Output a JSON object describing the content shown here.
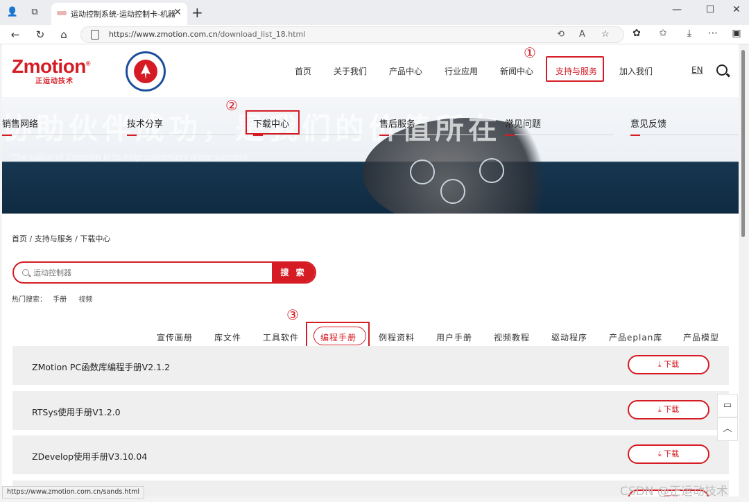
{
  "browser": {
    "tab_title": "运动控制系统-运动控制卡-机器人",
    "tab_close": "✕",
    "new_tab": "+",
    "url_host": "https://www.zmotion.com.cn",
    "url_path": "/download_list_18.html",
    "status_url": "https://www.zmotion.com.cn/sands.html"
  },
  "site": {
    "logo_text": "Zmotion",
    "logo_mark": "®",
    "logo_sub": "正运动技术",
    "nav": [
      "首页",
      "关于我们",
      "产品中心",
      "行业应用",
      "新闻中心",
      "支持与服务",
      "加入我们"
    ],
    "lang": "EN"
  },
  "banner": {
    "watermark": "协助伙伴成功，是我们的价值所在",
    "watermark_en": "The value of Zmotion is to help customers more success",
    "subnav": [
      "销售网络",
      "技术分享",
      "下载中心",
      "售后服务",
      "常见问题",
      "意见反馈"
    ]
  },
  "annotations": [
    "①",
    "②",
    "③"
  ],
  "breadcrumb": "首页 / 支持与服务 / 下载中心",
  "search": {
    "placeholder": "运动控制器",
    "button": "搜 索",
    "hot_label": "热门搜索：",
    "hot_items": [
      "手册",
      "视频"
    ]
  },
  "categories": [
    "宣传画册",
    "库文件",
    "工具软件",
    "编程手册",
    "例程资料",
    "用户手册",
    "视频教程",
    "驱动程序",
    "产品eplan库",
    "产品模型"
  ],
  "downloads": [
    {
      "name": "ZMotion PC函数库编程手册V2.1.2",
      "action": "下载"
    },
    {
      "name": "RTSys使用手册V1.2.0",
      "action": "下载"
    },
    {
      "name": "ZDevelop使用手册V3.10.04",
      "action": "下载"
    },
    {
      "name": "",
      "action": "下载"
    }
  ],
  "watermark_csdn": "CSDN @正运动技术"
}
